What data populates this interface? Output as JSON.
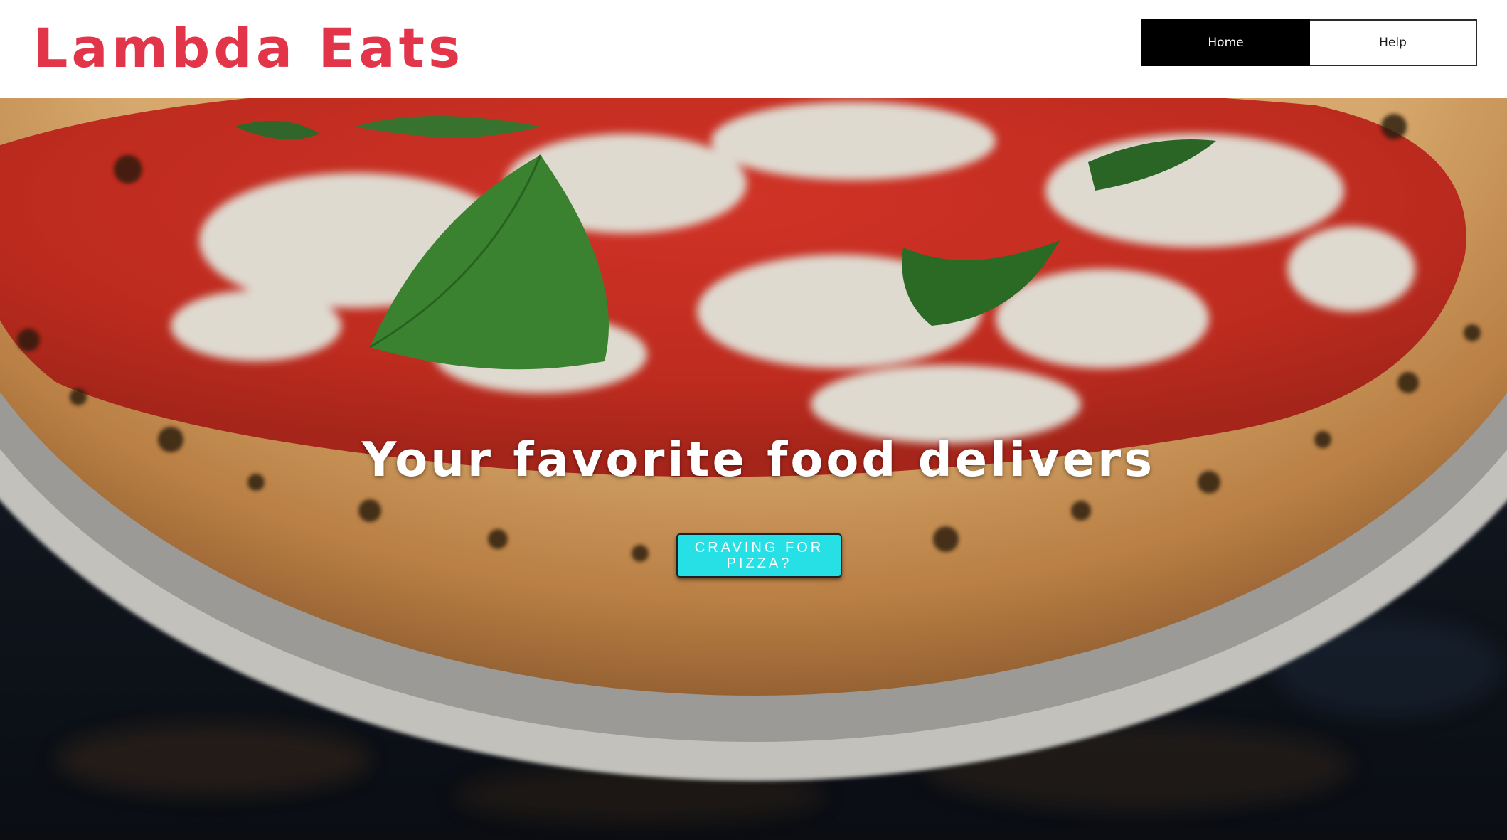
{
  "brand": {
    "name": "Lambda Eats",
    "color": "#e2354a"
  },
  "nav": {
    "items": [
      {
        "label": "Home",
        "active": true
      },
      {
        "label": "Help",
        "active": false
      }
    ]
  },
  "hero": {
    "image": "margherita-pizza-photo",
    "headline": "Your favorite food delivers",
    "cta_label": "CRAVING FOR PIZZA?",
    "cta_color": "#27e0e6"
  }
}
